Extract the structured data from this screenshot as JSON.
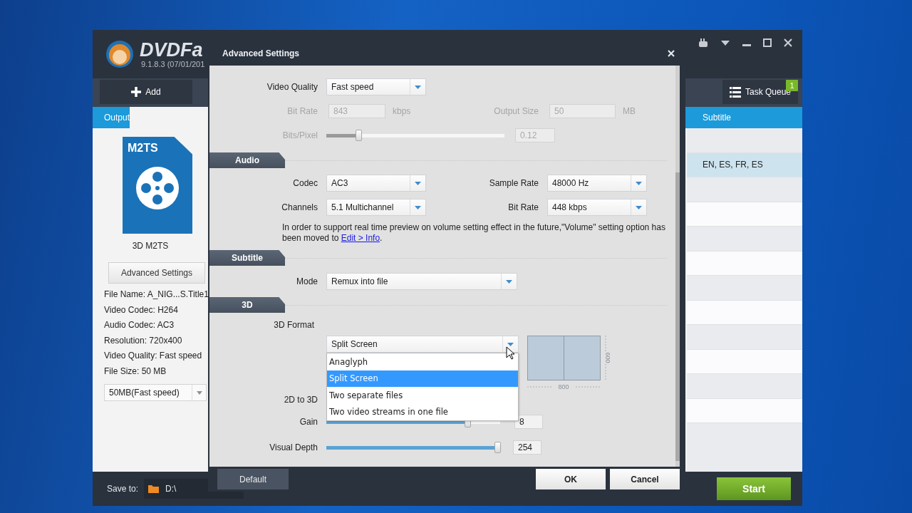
{
  "main_window": {
    "logo_text": "DVDFa",
    "version": "9.1.8.3 (07/01/201",
    "toolbar": {
      "add": "Add",
      "task_queue": "Task Queue",
      "queue_count": "1"
    },
    "output_panel": {
      "header": "Output",
      "file_type": "M2TS",
      "profile": "3D M2TS",
      "advanced_button": "Advanced Settings",
      "info": [
        "File Name: A_NIG...S.Title1",
        "Video Codec: H264",
        "Audio Codec: AC3",
        "Resolution: 720x400",
        "Video Quality: Fast speed",
        "File Size: 50 MB"
      ],
      "size_option": "50MB(Fast speed)"
    },
    "table": {
      "columns": [
        "Subtitle"
      ],
      "rows": [
        {
          "selected": false
        },
        {
          "subtitle": "EN, ES, FR, ES",
          "selected": true
        },
        {
          "selected": false
        },
        {
          "selected": false
        },
        {
          "selected": false
        },
        {
          "selected": false
        },
        {
          "selected": false
        },
        {
          "selected": false
        },
        {
          "selected": false
        },
        {
          "selected": false
        },
        {
          "selected": false
        },
        {
          "selected": false
        }
      ]
    },
    "save_to": {
      "label": "Save to:",
      "path": "D:\\"
    },
    "start": "Start"
  },
  "dialog": {
    "title": "Advanced Settings",
    "video": {
      "quality": {
        "label": "Video Quality",
        "value": "Fast speed"
      },
      "bit_rate": {
        "label": "Bit Rate",
        "value": "843",
        "unit": "kbps",
        "disabled": true
      },
      "output_size": {
        "label": "Output Size",
        "value": "50",
        "unit": "MB",
        "disabled": true
      },
      "bits_pixel": {
        "label": "Bits/Pixel",
        "level": 0.18,
        "value": "0.12",
        "disabled": true
      }
    },
    "audio": {
      "title": "Audio",
      "codec": {
        "label": "Codec",
        "value": "AC3"
      },
      "sample_rate": {
        "label": "Sample Rate",
        "value": "48000 Hz"
      },
      "channels": {
        "label": "Channels",
        "value": "5.1 Multichannel"
      },
      "bit_rate": {
        "label": "Bit Rate",
        "value": "448 kbps"
      },
      "note": "In order to support real time preview on volume setting effect in the future,\"Volume\" setting option has been moved to ",
      "link": "Edit > Info",
      "note_end": "."
    },
    "subtitle": {
      "title": "Subtitle",
      "mode": {
        "label": "Mode",
        "value": "Remux into file"
      }
    },
    "three_d": {
      "title": "3D",
      "format": {
        "label": "3D Format",
        "value": "Split Screen",
        "open": true,
        "options": [
          {
            "label": "Anaglyph",
            "selected": false
          },
          {
            "label": "Split Screen",
            "selected": true
          },
          {
            "label": "Two separate files",
            "selected": false
          },
          {
            "label": "Two video streams in one file",
            "selected": false
          }
        ]
      },
      "preview": {
        "height_label": "600",
        "width_label": "800"
      },
      "conversion_label": "2D to 3D",
      "gain": {
        "label": "Gain",
        "level": 0.81,
        "value": "8"
      },
      "visual_depth": {
        "label": "Visual Depth",
        "level": 1.0,
        "value": "254"
      }
    },
    "footer": {
      "default": "Default",
      "ok": "OK",
      "cancel": "Cancel"
    }
  }
}
